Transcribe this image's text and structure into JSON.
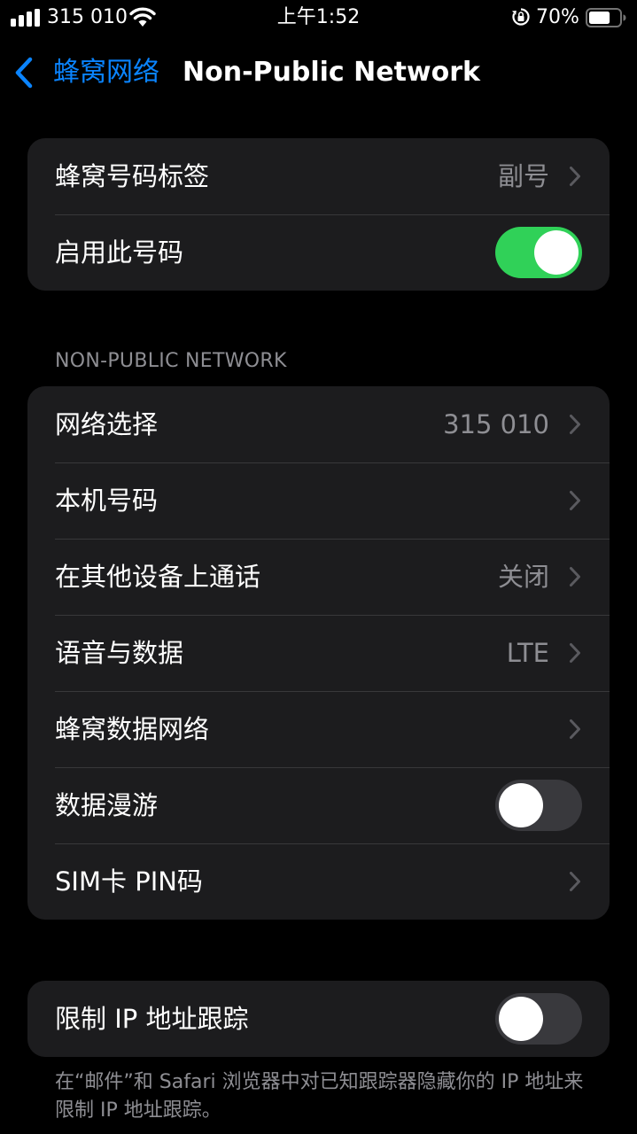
{
  "status_bar": {
    "carrier": "315 010",
    "time": "上午1:52",
    "battery_percent": "70%",
    "battery_level": 0.7,
    "icons": [
      "signal-bars-icon",
      "wifi-icon",
      "orientation-lock-icon",
      "battery-icon"
    ]
  },
  "nav": {
    "back_label": "蜂窝网络",
    "title": "Non-Public Network",
    "back_icon": "chevron-left-icon"
  },
  "colors": {
    "background": "#000000",
    "cell": "#1C1C1E",
    "accent": "#0A84FF",
    "toggle_on": "#30D158",
    "secondary_text": "#8E8E93"
  },
  "group1": {
    "rows": [
      {
        "label": "蜂窝号码标签",
        "value": "副号",
        "chevron": true
      },
      {
        "label": "启用此号码",
        "toggle": true
      }
    ]
  },
  "section_header": "NON-PUBLIC NETWORK",
  "group2": {
    "rows": [
      {
        "label": "网络选择",
        "value": "315 010",
        "chevron": true
      },
      {
        "label": "本机号码",
        "value": "",
        "chevron": true
      },
      {
        "label": "在其他设备上通话",
        "value": "关闭",
        "chevron": true
      },
      {
        "label": "语音与数据",
        "value": "LTE",
        "chevron": true
      },
      {
        "label": "蜂窝数据网络",
        "value": "",
        "chevron": true
      },
      {
        "label": "数据漫游",
        "toggle": false
      },
      {
        "label": "SIM卡 PIN码",
        "value": "",
        "chevron": true
      }
    ]
  },
  "group3": {
    "rows": [
      {
        "label": "限制 IP 地址跟踪",
        "toggle": false
      }
    ]
  },
  "footer_text": "在“邮件”和 Safari 浏览器中对已知跟踪器隐藏你的 IP 地址来限制 IP 地址跟踪。"
}
